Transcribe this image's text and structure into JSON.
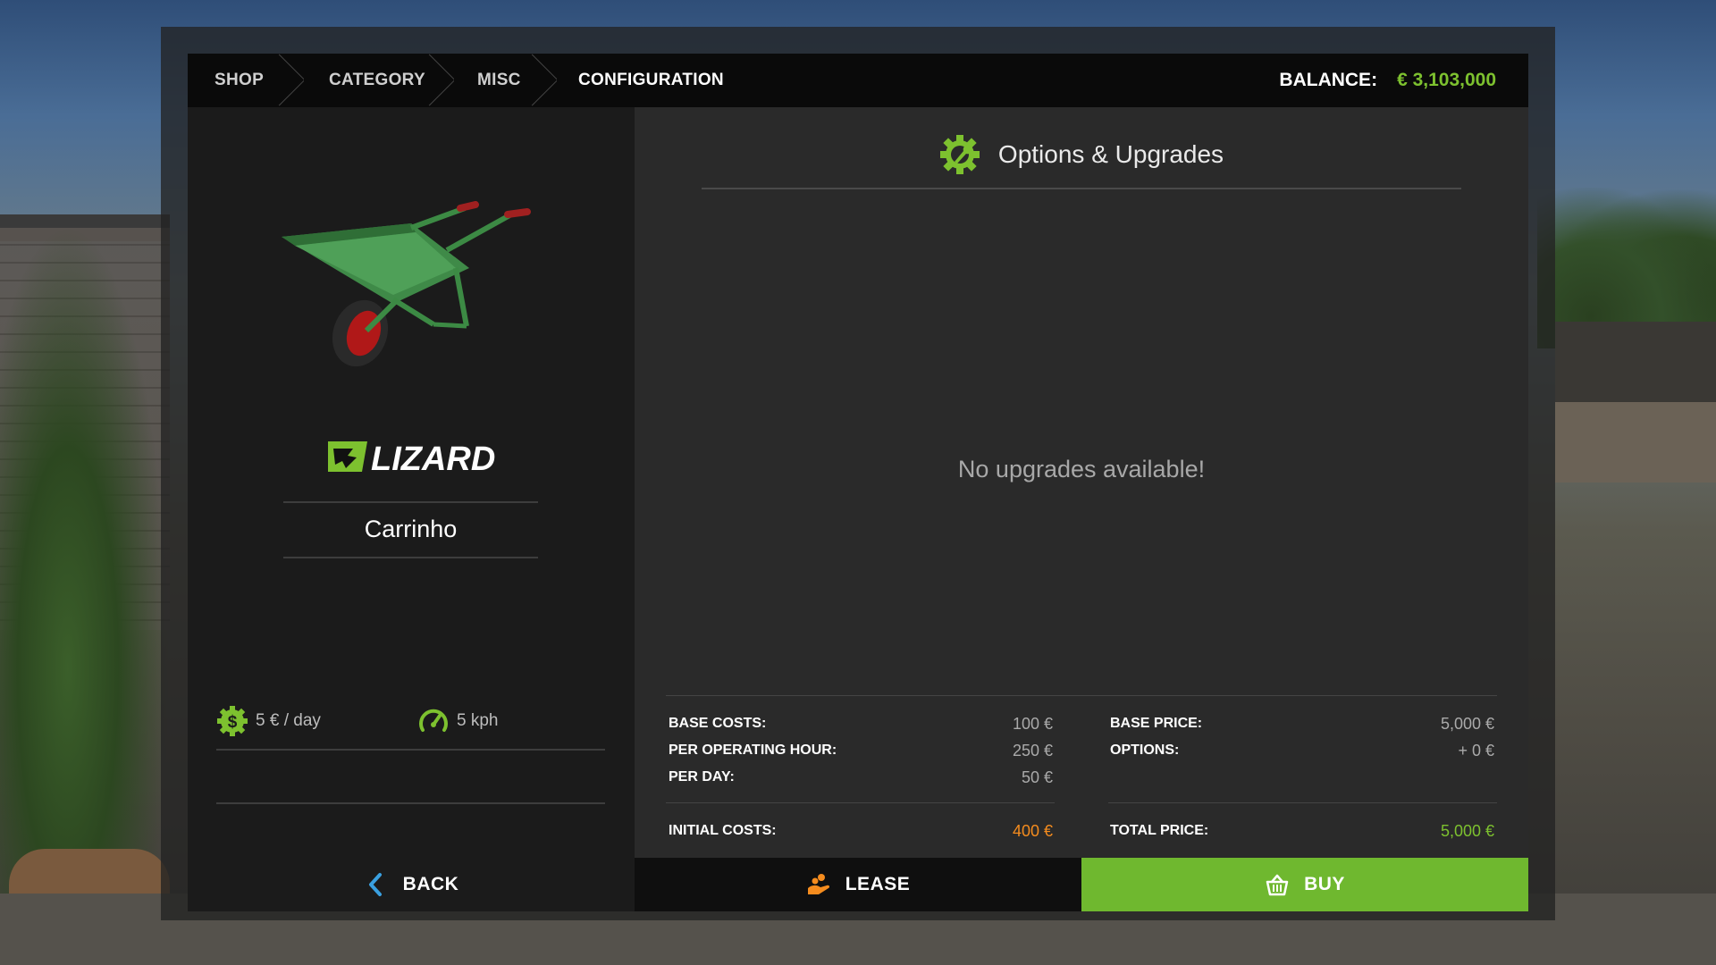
{
  "breadcrumbs": [
    "SHOP",
    "CATEGORY",
    "MISC",
    "CONFIGURATION"
  ],
  "balance": {
    "label": "BALANCE:",
    "value": "€ 3,103,000"
  },
  "vehicle": {
    "brand": "LIZARD",
    "name": "Carrinho",
    "maintenance": "5 € / day",
    "speed": "5 kph"
  },
  "options": {
    "title": "Options & Upgrades",
    "empty_message": "No upgrades available!"
  },
  "lease_costs": [
    {
      "label": "BASE COSTS:",
      "value": "100 €"
    },
    {
      "label": "PER OPERATING HOUR:",
      "value": "250 €"
    },
    {
      "label": "PER DAY:",
      "value": "50 €"
    }
  ],
  "initial_costs": {
    "label": "INITIAL COSTS:",
    "value": "400 €"
  },
  "purchase_costs": [
    {
      "label": "BASE PRICE:",
      "value": "5,000 €"
    },
    {
      "label": "OPTIONS:",
      "value": "+ 0 €"
    }
  ],
  "total_price": {
    "label": "TOTAL PRICE:",
    "value": "5,000 €"
  },
  "buttons": {
    "back": "BACK",
    "lease": "LEASE",
    "buy": "BUY"
  },
  "colors": {
    "accent_green": "#7dc12f",
    "buy_green": "#6fb82f",
    "orange": "#f58c1e"
  },
  "icons": {
    "maintenance": "dollar-gear-icon",
    "speed": "speedometer-icon",
    "options": "wrench-gear-icon",
    "back": "chevron-left-icon",
    "lease": "hand-coins-icon",
    "buy": "shopping-basket-icon"
  }
}
